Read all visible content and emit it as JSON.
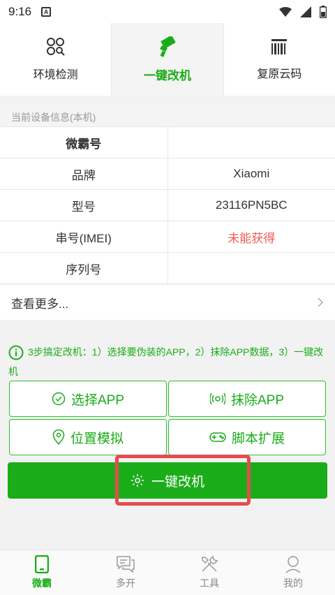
{
  "status": {
    "time": "9:16",
    "notification_letter": "A"
  },
  "top_tabs": [
    {
      "label": "环境检测",
      "icon": "circles-search-icon"
    },
    {
      "label": "一键改机",
      "icon": "brush-icon"
    },
    {
      "label": "复原云码",
      "icon": "barcode-icon"
    }
  ],
  "section_title": "当前设备信息(本机)",
  "device_info": [
    {
      "key": "微霸号",
      "value": ""
    },
    {
      "key": "品牌",
      "value": "Xiaomi"
    },
    {
      "key": "型号",
      "value": "23116PN5BC"
    },
    {
      "key": "串号(IMEI)",
      "value": "未能获得"
    },
    {
      "key": "序列号",
      "value": ""
    }
  ],
  "more_label": "查看更多...",
  "tip_text": "3步搞定改机：1）选择要伪装的APP，2）抹除APP数据，3）一键改机",
  "actions": {
    "select_app": "选择APP",
    "erase_app": "抹除APP",
    "location_sim": "位置模拟",
    "script_ext": "脚本扩展"
  },
  "main_button": "一键改机",
  "colors": {
    "accent": "#1aad19",
    "warning": "#f25b55",
    "highlight": "#e54c4c"
  },
  "bottom_nav": [
    {
      "label": "微霸",
      "icon": "phone-icon"
    },
    {
      "label": "多开",
      "icon": "chat-bubbles-icon"
    },
    {
      "label": "工具",
      "icon": "tools-icon"
    },
    {
      "label": "我的",
      "icon": "user-icon"
    }
  ]
}
